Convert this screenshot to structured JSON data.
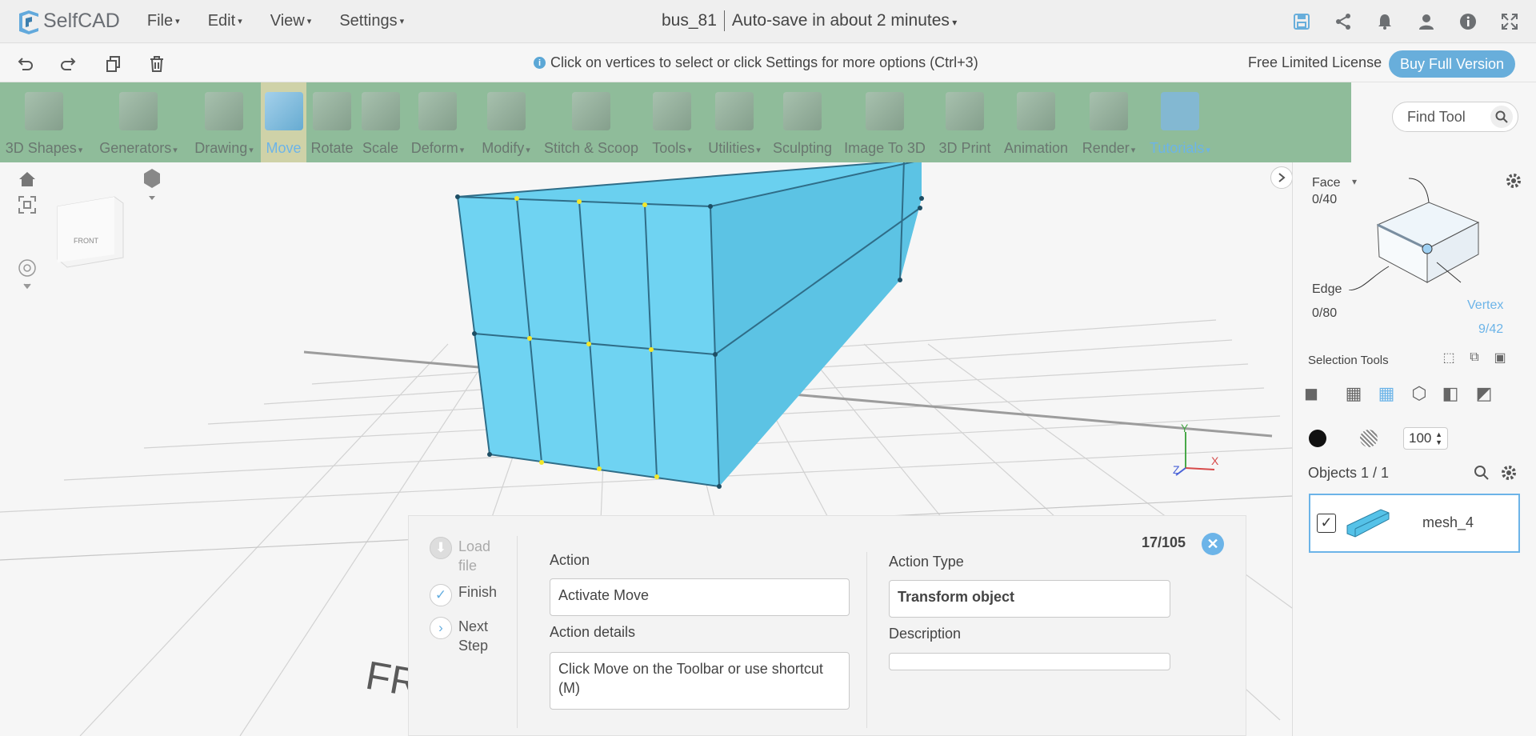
{
  "app": {
    "name": "SelfCAD"
  },
  "menu": [
    "File",
    "Edit",
    "View",
    "Settings"
  ],
  "project": {
    "name": "bus_81",
    "autosave": "Auto-save in about 2 minutes"
  },
  "top_icons": [
    "save-icon",
    "share-icon",
    "bell-icon",
    "user-icon",
    "info-icon",
    "fullscreen-icon"
  ],
  "hint": "Click on vertices to select or click Settings for more options (Ctrl+3)",
  "license": {
    "text": "Free Limited License",
    "buy": "Buy Full Version"
  },
  "toolbar": {
    "tools": [
      "3D Shapes",
      "Generators",
      "Drawing",
      "Move",
      "Rotate",
      "Scale",
      "Deform",
      "Modify",
      "Stitch & Scoop",
      "Tools",
      "Utilities",
      "Sculpting",
      "Image To 3D",
      "3D Print",
      "Animation",
      "Render",
      "Tutorials"
    ],
    "active": "Move"
  },
  "find_tool": {
    "placeholder": "Find Tool"
  },
  "selection": {
    "face_label": "Face",
    "face_count": "0/40",
    "edge_label": "Edge",
    "edge_count": "0/80",
    "vertex_label": "Vertex",
    "vertex_count": "9/42",
    "tools_label": "Selection Tools",
    "size_value": "100"
  },
  "objects": {
    "label": "Objects 1 / 1",
    "items": [
      {
        "name": "mesh_4",
        "checked": true
      }
    ]
  },
  "viewcube": {
    "face": "FRONT"
  },
  "axes": {
    "x": "X",
    "y": "Y",
    "z": "Z"
  },
  "floor_text": "FR",
  "tutorial": {
    "counter": "17/105",
    "steps": [
      "Load file",
      "Finish",
      "Next Step"
    ],
    "action_label": "Action",
    "action_value": "Activate Move",
    "action_details_label": "Action details",
    "action_details_value": "Click Move on the Toolbar or use shortcut (M)",
    "action_type_label": "Action Type",
    "action_type_value": "Transform object",
    "description_label": "Description",
    "description_value": ""
  }
}
